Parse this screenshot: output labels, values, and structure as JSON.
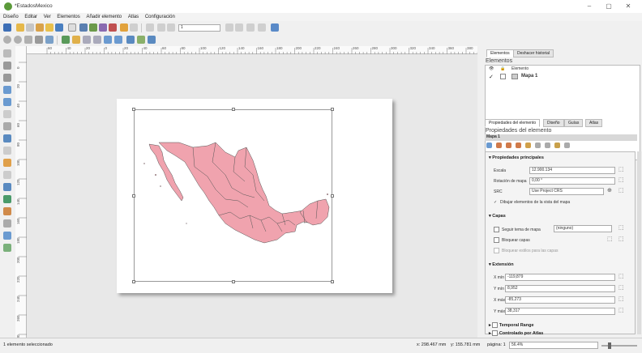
{
  "window": {
    "title": "*EstadosMexico",
    "minimize": "–",
    "maximize": "▢",
    "close": "✕"
  },
  "menu": [
    "Diseño",
    "Editar",
    "Ver",
    "Elementos",
    "Añadir elemento",
    "Atlas",
    "Configuración"
  ],
  "toolbar2": {
    "atlas_page": "1"
  },
  "ruler_labels": [
    "60",
    "40",
    "20",
    "0",
    "20",
    "40",
    "60",
    "80",
    "100",
    "120",
    "140",
    "160",
    "180",
    "200",
    "220",
    "240",
    "260",
    "280",
    "300",
    "320",
    "340",
    "360",
    "380"
  ],
  "vruler_labels": [
    "0",
    "20",
    "40",
    "60",
    "80",
    "100",
    "120",
    "140",
    "160",
    "180",
    "200",
    "220",
    "240",
    "260",
    "280"
  ],
  "items_panel": {
    "tabs": [
      "Elementos",
      "Deshacer historial"
    ],
    "title": "Elementos",
    "col_header": "Elemento",
    "item": "Mapa 1"
  },
  "props_panel": {
    "tabs": [
      "Propiedades del elemento",
      "Diseño",
      "Guías",
      "Atlas"
    ],
    "title": "Propiedades del elemento",
    "subtitle": "Mapa 1",
    "main_section": "Propiedades principales",
    "escala_label": "Escala",
    "escala_value": "12.900.134",
    "rotacion_label": "Rotación de mapa",
    "rotacion_value": "0,00 °",
    "src_label": "SRC",
    "src_value": "Use Project CRS",
    "dibujar_label": "Dibujar elementos de la vista del mapa",
    "capas_section": "Capas",
    "seguir_label": "Seguir tema de mapa",
    "seguir_value": "(ninguno)",
    "bloquear_label": "Bloquear capas",
    "bloquear_estilos_label": "Bloquear estilos para las capas",
    "extension_section": "Extensión",
    "xmin_label": "X mín",
    "xmin_value": "-119,879",
    "ymin_label": "Y mín",
    "ymin_value": "8,952",
    "xmax_label": "X máx",
    "xmax_value": "-85,273",
    "ymax_label": "Y máx",
    "ymax_value": "38,317",
    "temporal_section": "Temporal Range",
    "atlas_section": "Controlado por Atlas"
  },
  "status": {
    "left": "1 elemento seleccionado",
    "x": "x: 298.467 mm",
    "y": "y: 155.781 mm",
    "page": "página: 1",
    "zoom": "56.4%"
  },
  "colors": {
    "map_fill": "#f0a3ae",
    "map_stroke": "#555555",
    "accent": "#3a7bc8"
  }
}
